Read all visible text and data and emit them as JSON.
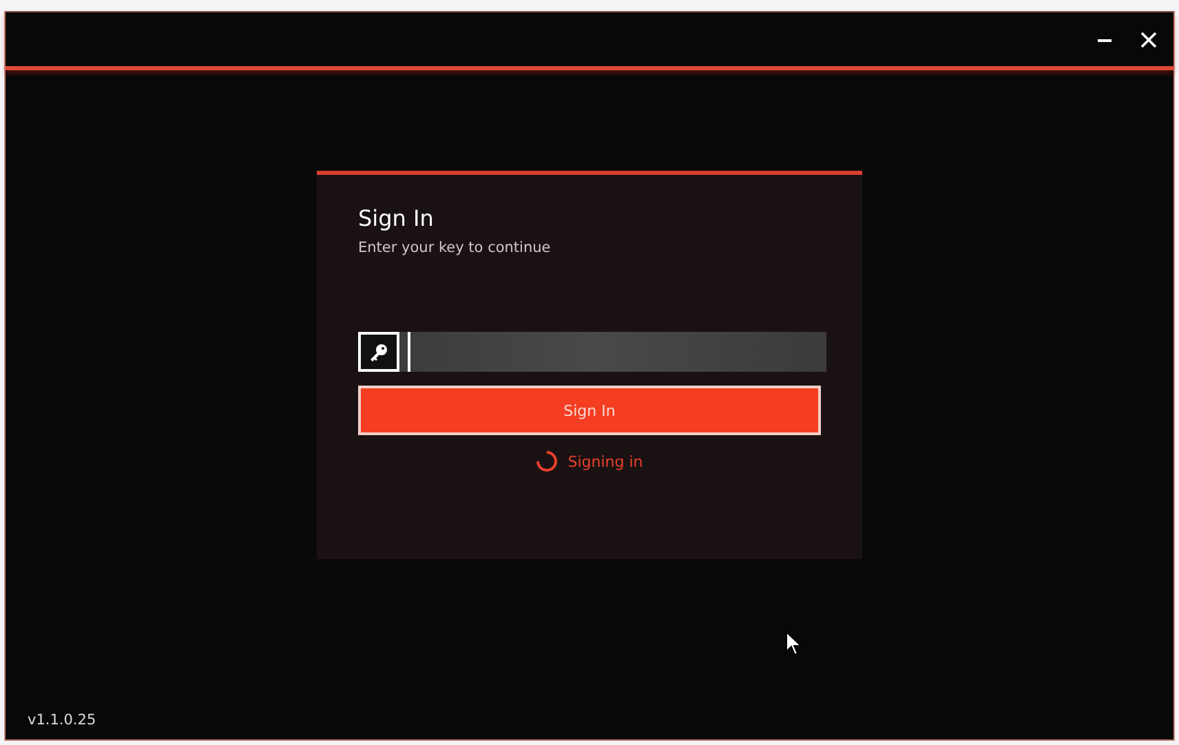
{
  "window": {
    "controls": [
      {
        "kind": "minimize"
      },
      {
        "kind": "close"
      }
    ]
  },
  "sign_in": {
    "title": "Sign In",
    "subtitle": "Enter your key to continue",
    "button": "Sign In",
    "status": {
      "text": "Signing in",
      "loading": true
    }
  },
  "version": "v1.1.0.25"
}
